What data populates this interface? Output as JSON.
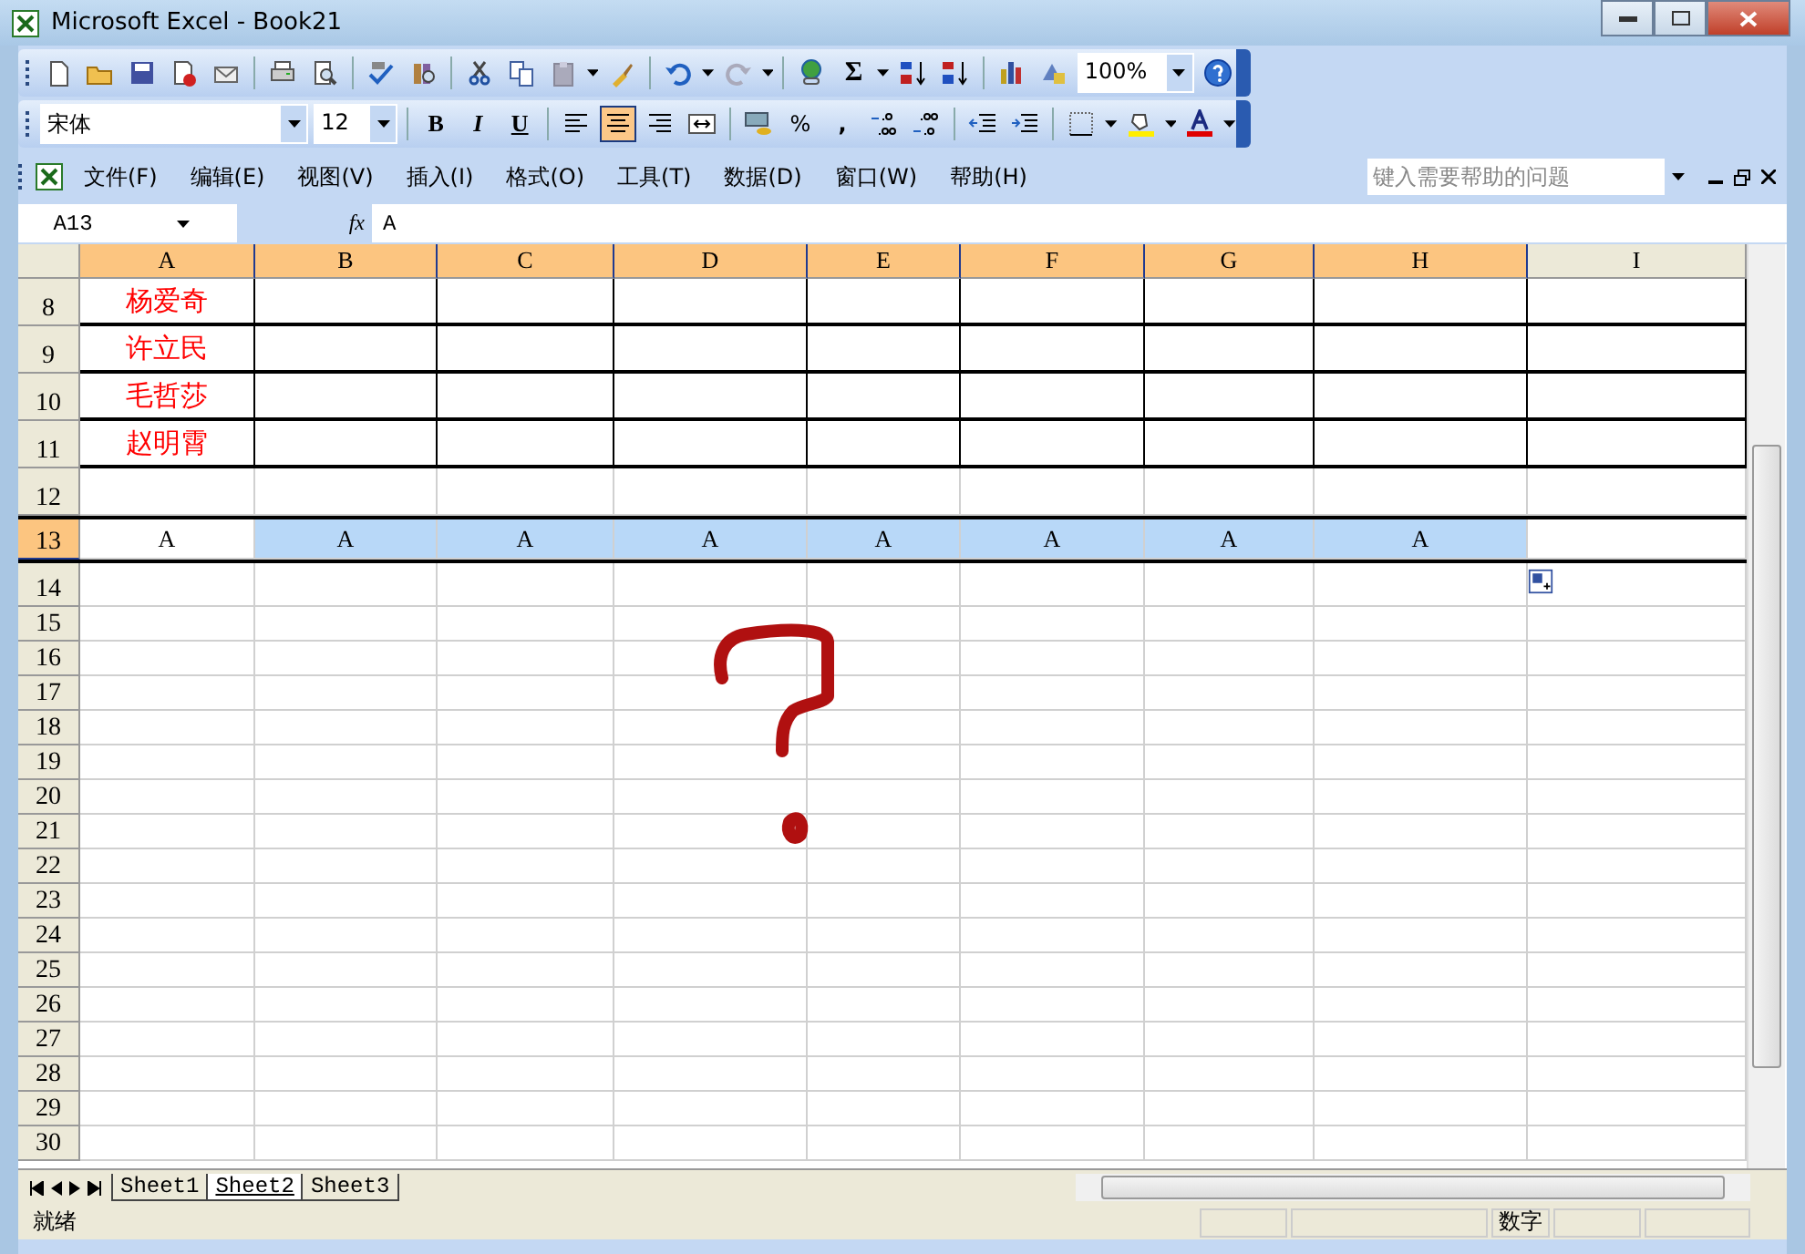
{
  "window": {
    "title": "Microsoft Excel - Book21"
  },
  "standard_toolbar": {
    "sum": "Σ",
    "zoom": "100%"
  },
  "format_toolbar": {
    "font": "宋体",
    "size": "12",
    "bold": "B",
    "italic": "I",
    "underline": "U",
    "percent": "%",
    "comma": ",",
    "align_buttons": [
      {
        "selected": false
      },
      {
        "selected": true
      },
      {
        "selected": false
      }
    ]
  },
  "menu": [
    "文件(F)",
    "编辑(E)",
    "视图(V)",
    "插入(I)",
    "格式(O)",
    "工具(T)",
    "数据(D)",
    "窗口(W)",
    "帮助(H)"
  ],
  "help_search": {
    "placeholder": "键入需要帮助的问题"
  },
  "formula_bar": {
    "name_box": "A13",
    "fx": "fx",
    "value": "A"
  },
  "columns": [
    {
      "label": "A",
      "selected": true
    },
    {
      "label": "B",
      "selected": true
    },
    {
      "label": "C",
      "selected": true
    },
    {
      "label": "D",
      "selected": true
    },
    {
      "label": "E",
      "selected": true
    },
    {
      "label": "F",
      "selected": true
    },
    {
      "label": "G",
      "selected": true
    },
    {
      "label": "H",
      "selected": true
    },
    {
      "label": "I",
      "selected": false
    }
  ],
  "rows": [
    {
      "header": "8",
      "kind": "name",
      "selected": false,
      "cells": [
        "杨爱奇"
      ]
    },
    {
      "header": "9",
      "kind": "name",
      "selected": false,
      "cells": [
        "许立民"
      ]
    },
    {
      "header": "10",
      "kind": "name",
      "selected": false,
      "cells": [
        "毛哲莎"
      ]
    },
    {
      "header": "11",
      "kind": "name",
      "selected": false,
      "cells": [
        "赵明霄"
      ]
    },
    {
      "header": "12",
      "kind": "plain",
      "selected": false,
      "cells": []
    },
    {
      "header": "13",
      "kind": "plain",
      "selected": true,
      "cells": [
        "A",
        "A",
        "A",
        "A",
        "A",
        "A",
        "A",
        "A"
      ]
    },
    {
      "header": "14",
      "kind": "plain",
      "selected": false,
      "cells": []
    },
    {
      "header": "15",
      "kind": "plain",
      "selected": false,
      "cells": []
    },
    {
      "header": "16",
      "kind": "plain",
      "selected": false,
      "cells": []
    },
    {
      "header": "17",
      "kind": "plain",
      "selected": false,
      "cells": []
    },
    {
      "header": "18",
      "kind": "plain",
      "selected": false,
      "cells": []
    },
    {
      "header": "19",
      "kind": "plain",
      "selected": false,
      "cells": []
    },
    {
      "header": "20",
      "kind": "plain",
      "selected": false,
      "cells": []
    },
    {
      "header": "21",
      "kind": "plain",
      "selected": false,
      "cells": []
    },
    {
      "header": "22",
      "kind": "plain",
      "selected": false,
      "cells": []
    },
    {
      "header": "23",
      "kind": "plain",
      "selected": false,
      "cells": []
    },
    {
      "header": "24",
      "kind": "plain",
      "selected": false,
      "cells": []
    },
    {
      "header": "25",
      "kind": "plain",
      "selected": false,
      "cells": []
    },
    {
      "header": "26",
      "kind": "plain",
      "selected": false,
      "cells": []
    },
    {
      "header": "27",
      "kind": "plain",
      "selected": false,
      "cells": []
    },
    {
      "header": "28",
      "kind": "plain",
      "selected": false,
      "cells": []
    },
    {
      "header": "29",
      "kind": "plain",
      "selected": false,
      "cells": []
    },
    {
      "header": "30",
      "kind": "plain",
      "selected": false,
      "cells": []
    }
  ],
  "sheet_tabs": [
    {
      "label": "Sheet1",
      "selected": false
    },
    {
      "label": "Sheet2",
      "selected": true
    },
    {
      "label": "Sheet3",
      "selected": false
    }
  ],
  "status_bar": {
    "text": "就绪",
    "mode": "数字"
  }
}
